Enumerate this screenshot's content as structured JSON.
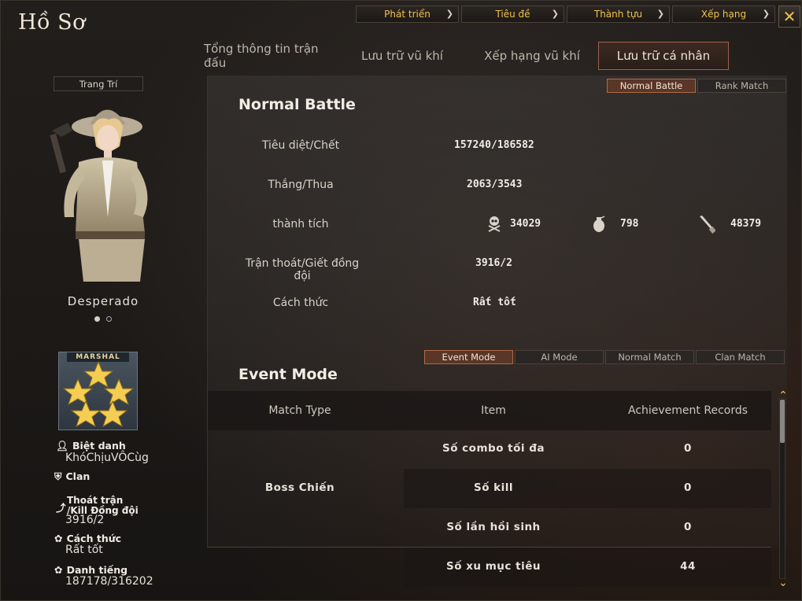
{
  "window": {
    "title": "Hồ Sơ"
  },
  "top_nav": [
    {
      "label": "Phát triển"
    },
    {
      "label": "Tiêu đề"
    },
    {
      "label": "Thành tựu"
    },
    {
      "label": "Xếp hạng"
    }
  ],
  "main_tabs": [
    {
      "label": "Tổng thông tin trận đấu",
      "active": false
    },
    {
      "label": "Lưu trữ vũ khí",
      "active": false
    },
    {
      "label": "Xếp hạng vũ khí",
      "active": false
    },
    {
      "label": "Lưu trữ cá nhân",
      "active": true
    }
  ],
  "character": {
    "decor_button": "Trang Trí",
    "name": "Desperado",
    "rank_badge_text": "MARSHAL",
    "rank_stars": 5
  },
  "profile": {
    "nickname_label": "Biệt danh",
    "nickname_value": "KhóChịuVÔCùg",
    "clan_label": "Clan",
    "clan_value": "",
    "escape_label_1": "Thoát trận",
    "escape_label_2": "/Kill Đồng đội",
    "escape_value": "3916/2",
    "manner_label": "Cách thức",
    "manner_value": "Rất tốt",
    "reputation_label": "Danh tiếng",
    "reputation_value": "187178/316202"
  },
  "normal_battle": {
    "mode_tabs": [
      {
        "label": "Normal Battle",
        "active": true
      },
      {
        "label": "Rank Match",
        "active": false
      }
    ],
    "title": "Normal Battle",
    "kd_label": "Tiêu diệt/Chết",
    "kd_value": "157240/186582",
    "wl_label": "Thắng/Thua",
    "wl_value": "2063/3543",
    "achievement_label": "thành tích",
    "headshot_value": "34029",
    "grenade_value": "798",
    "knife_value": "48379",
    "escape_label": "Trận thoát/Giết đồng đội",
    "escape_value": "3916/2",
    "manner_label": "Cách thức",
    "manner_value": "Rất tốt"
  },
  "event_mode": {
    "title": "Event Mode",
    "mode_tabs": [
      {
        "label": "Event Mode",
        "active": true
      },
      {
        "label": "AI Mode",
        "active": false
      },
      {
        "label": "Normal Match",
        "active": false
      },
      {
        "label": "Clan Match",
        "active": false
      }
    ],
    "columns": [
      "Match Type",
      "Item",
      "Achievement Records"
    ],
    "match_type": "Boss Chiến",
    "rows": [
      {
        "item": "Số combo tối đa",
        "value": "0"
      },
      {
        "item": "Số kill",
        "value": "0"
      },
      {
        "item": "Số lần hồi sinh",
        "value": "0"
      },
      {
        "item": "Số xu mục tiêu",
        "value": "44"
      }
    ]
  },
  "icons": {
    "close": "close-icon",
    "chevron": "chevron-right-icon",
    "headshot": "skull-crossbones-icon",
    "grenade": "grenade-icon",
    "knife": "knife-icon",
    "person": "person-icon",
    "clan": "clan-shield-icon",
    "runner": "runner-icon",
    "flower": "clover-icon",
    "scroll_up": "chevron-up-icon",
    "scroll_down": "chevron-down-icon"
  },
  "colors": {
    "accent": "#f2c24b",
    "active_tab": "#5a3626",
    "active_border": "#b06a4a",
    "text": "#f0ebe4"
  }
}
